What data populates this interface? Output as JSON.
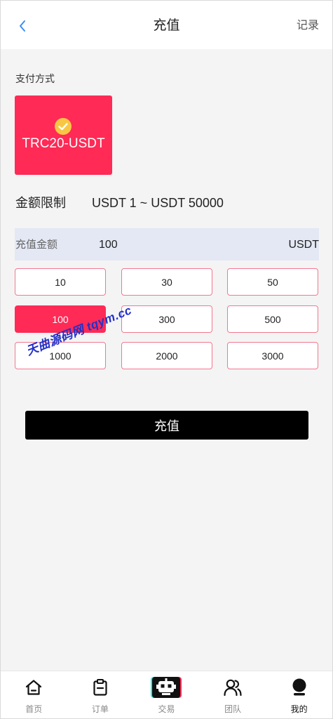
{
  "header": {
    "back_icon": "chevron-left-icon",
    "title": "充值",
    "right_link": "记录"
  },
  "payment": {
    "label": "支付方式",
    "methods": [
      {
        "name": "TRC20-USDT",
        "selected": true,
        "icon": "check-circle-icon"
      }
    ]
  },
  "limit": {
    "label": "金额限制",
    "range": "USDT 1 ~ USDT 50000"
  },
  "amount_input": {
    "label": "充值金额",
    "value": "100",
    "unit": "USDT"
  },
  "amount_options": [
    "10",
    "30",
    "50",
    "100",
    "300",
    "500",
    "1000",
    "2000",
    "3000"
  ],
  "selected_amount": "100",
  "watermark": "天曲源码网 tqym.cc",
  "submit_label": "充值",
  "nav": {
    "active": "我的",
    "items": [
      {
        "label": "首页",
        "icon": "home-icon"
      },
      {
        "label": "订单",
        "icon": "clipboard-icon"
      },
      {
        "label": "交易",
        "icon": "robot-icon"
      },
      {
        "label": "团队",
        "icon": "team-icon"
      },
      {
        "label": "我的",
        "icon": "user-icon"
      }
    ]
  },
  "colors": {
    "accent": "#ff2a56",
    "check": "#f7c744",
    "input_bg": "#e3e8f4",
    "button_border": "#f27891",
    "link": "#3a8ef5",
    "submit": "#000000"
  }
}
